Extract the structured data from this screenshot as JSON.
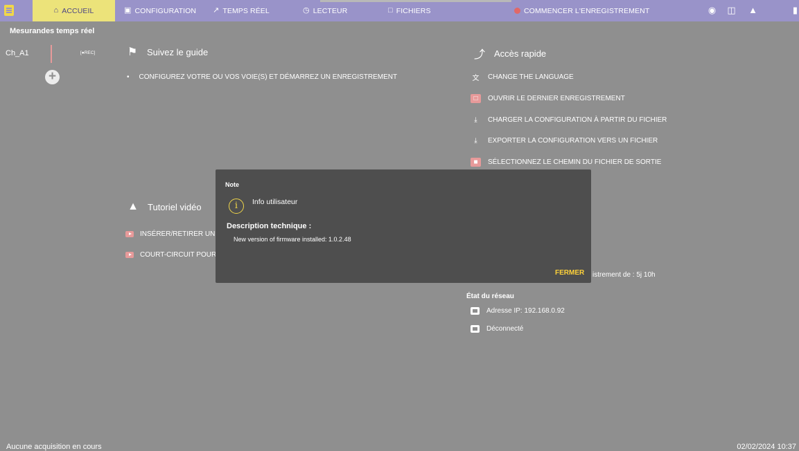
{
  "topbar": {
    "tabs": [
      {
        "label": "ACCUEIL",
        "icon": "home-icon"
      },
      {
        "label": "CONFIGURATION",
        "icon": "config-icon"
      },
      {
        "label": "TEMPS RÉEL",
        "icon": "realtime-icon"
      },
      {
        "label": "LECTEUR",
        "icon": "player-icon"
      },
      {
        "label": "FICHIERS",
        "icon": "folder-icon"
      }
    ],
    "record_label": "COMMENCER L'ENREGISTREMENT",
    "colors": {
      "bar": "#9993c9",
      "active_tab": "#ece37a",
      "record_dot": "#e06868"
    }
  },
  "left_panel": {
    "title": "Mesurandes temps réel",
    "channel": {
      "name": "Ch_A1",
      "tag": "[●REC]"
    }
  },
  "guide": {
    "title": "Suivez le guide",
    "item": "CONFIGUREZ VOTRE OU VOS VOIE(S) ET DÉMARREZ UN ENREGISTREMENT"
  },
  "quick_access": {
    "title": "Accès rapide",
    "items": [
      {
        "label": "CHANGE THE LANGUAGE",
        "icon": "translate-icon"
      },
      {
        "label": "OUVRIR LE DERNIER ENREGISTREMENT",
        "icon": "file-icon"
      },
      {
        "label": "CHARGER LA CONFIGURATION À PARTIR DU FICHIER",
        "icon": "download-icon"
      },
      {
        "label": "EXPORTER LA CONFIGURATION VERS UN FICHIER",
        "icon": "download-icon"
      },
      {
        "label": "SÉLECTIONNEZ LE CHEMIN DU FICHIER DE SORTIE",
        "icon": "folder-icon"
      }
    ]
  },
  "tutorial": {
    "title": "Tutoriel vidéo",
    "items": [
      {
        "label": "INSÉRER/RETIRER UNE"
      },
      {
        "label": "COURT-CIRCUIT POUR "
      }
    ]
  },
  "recording_time_partial": "istrement de : 5j 10h",
  "network": {
    "title": "État du réseau",
    "ip": "Adresse IP: 192.168.0.92",
    "status": "Déconnecté"
  },
  "modal": {
    "title": "Note",
    "info": "Info utilisateur",
    "desc_label": "Description technique :",
    "desc_text": "New version of firmware installed: 1.0.2.48",
    "close_label": "FERMER",
    "accent": "#ffd23a"
  },
  "status_bar": {
    "left": "Aucune acquisition en cours",
    "right": "02/02/2024 10:37"
  }
}
